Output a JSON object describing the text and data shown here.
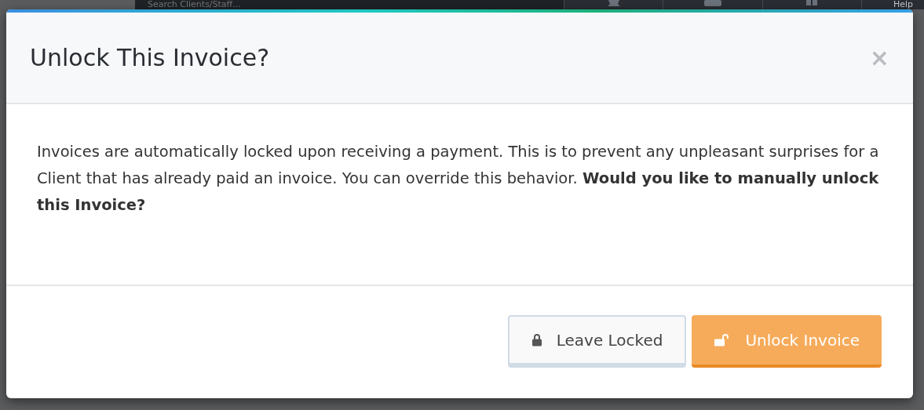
{
  "topbar": {
    "search": {
      "placeholder": "Search Clients/Staff..."
    },
    "help": "Help"
  },
  "dialog": {
    "title": "Unlock This Invoice?",
    "close": "×",
    "message": "Invoices are automatically locked upon receiving a payment. This is to prevent any unpleasant surprises for a Client that has already paid an invoice. You can override this behavior. **Would you like to manually unlock this Invoice?**",
    "buttons": [
      {
        "label": "Leave Locked",
        "kind": "default"
      },
      {
        "label": "Unlock Invoice",
        "kind": "primary"
      }
    ]
  }
}
